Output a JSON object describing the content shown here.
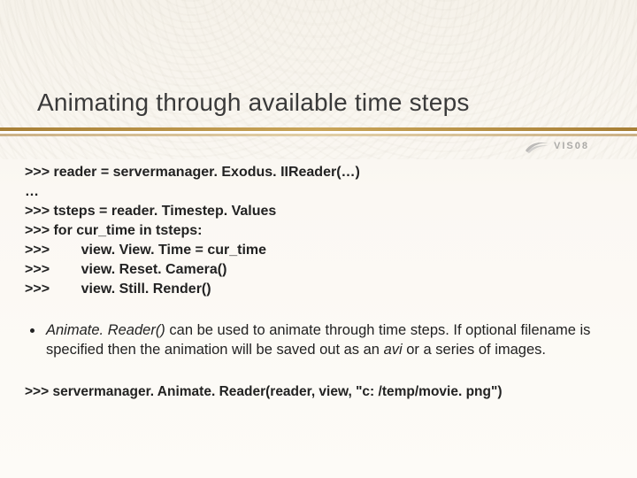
{
  "title": "Animating through available time steps",
  "logo": {
    "text": "VIS08"
  },
  "code": {
    "lines": [
      ">>> reader = servermanager. Exodus. IIReader(…)",
      "…",
      ">>> tsteps = reader. Timestep. Values",
      ">>> for cur_time in tsteps:",
      ">>>        view. View. Time = cur_time",
      ">>>        view. Reset. Camera()",
      ">>>        view. Still. Render()"
    ]
  },
  "bullet": {
    "prefix": "",
    "fn": "Animate. Reader()",
    "mid": " can be used to animate through time steps. If optional filename is specified then the animation will be saved out as an ",
    "avi": "avi",
    "tail": " or a series of images."
  },
  "bottom_code": ">>> servermanager. Animate. Reader(reader, view, \"c: /temp/movie. png\")"
}
